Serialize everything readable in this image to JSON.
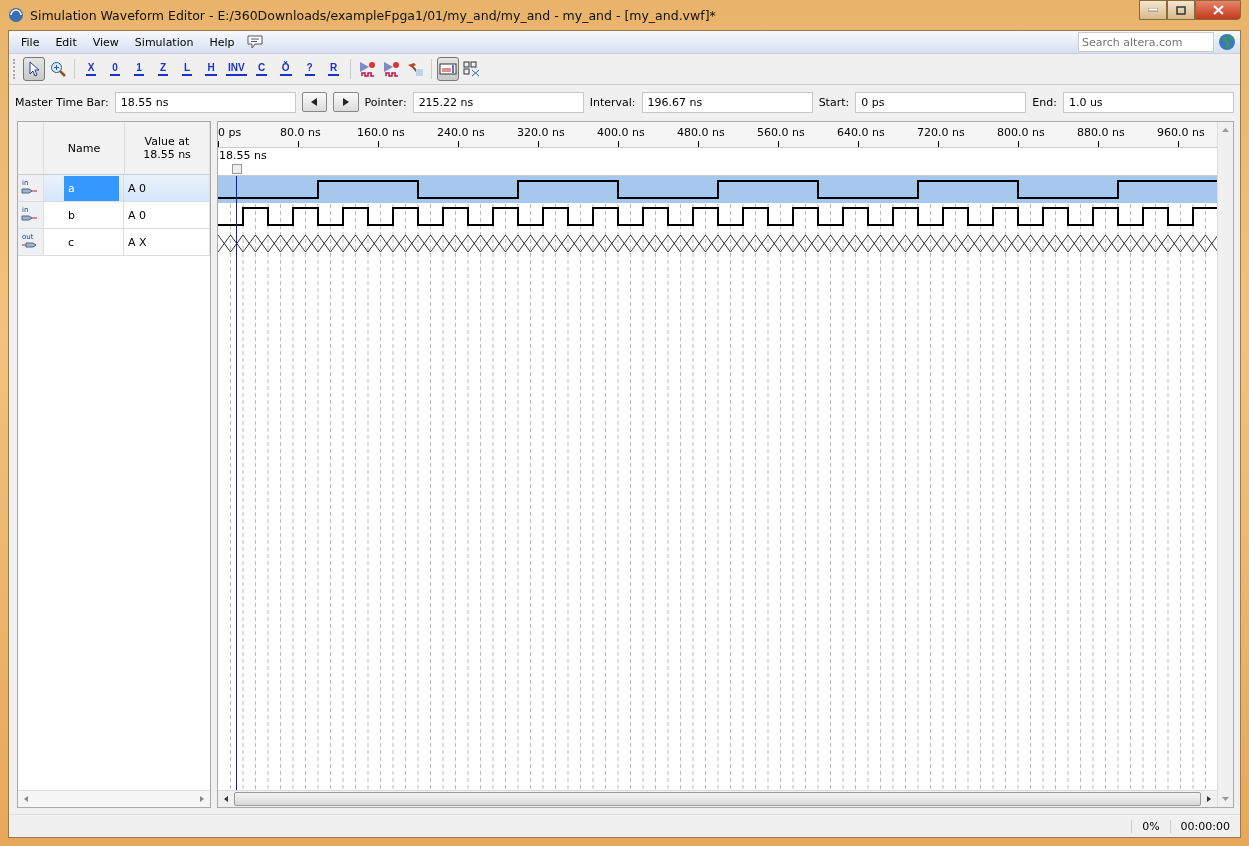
{
  "window": {
    "title": "Simulation Waveform Editor - E:/360Downloads/exampleFpga1/01/my_and/my_and - my_and - [my_and.vwf]*"
  },
  "menu": [
    "File",
    "Edit",
    "View",
    "Simulation",
    "Help"
  ],
  "search": {
    "placeholder": "Search altera.com"
  },
  "toolbar": [
    {
      "kind": "select",
      "selected": true
    },
    {
      "kind": "zoom",
      "selected": false
    },
    {
      "kind": "glyph",
      "glyph": "X",
      "selected": false
    },
    {
      "kind": "glyph",
      "glyph": "0",
      "selected": false
    },
    {
      "kind": "glyph",
      "glyph": "1",
      "selected": false
    },
    {
      "kind": "glyph",
      "glyph": "Z",
      "selected": false
    },
    {
      "kind": "glyph",
      "glyph": "L",
      "selected": false
    },
    {
      "kind": "glyph",
      "glyph": "H",
      "selected": false
    },
    {
      "kind": "glyph",
      "glyph": "INV",
      "selected": false
    },
    {
      "kind": "glyph",
      "glyph": "C",
      "selected": false
    },
    {
      "kind": "glyph",
      "glyph": "Ŏ",
      "selected": false
    },
    {
      "kind": "glyph",
      "glyph": "?",
      "selected": false
    },
    {
      "kind": "glyph",
      "glyph": "R",
      "selected": false
    },
    {
      "kind": "sim",
      "selected": false
    },
    {
      "kind": "sim",
      "selected": false
    },
    {
      "kind": "hammer",
      "selected": false
    },
    {
      "kind": "layout",
      "selected": true
    },
    {
      "kind": "grid",
      "selected": false
    }
  ],
  "timebar": {
    "master_label": "Master Time Bar:",
    "master": "18.55 ns",
    "pointer_label": "Pointer:",
    "pointer": "215.22 ns",
    "interval_label": "Interval:",
    "interval": "196.67 ns",
    "start_label": "Start:",
    "start": "0 ps",
    "end_label": "End:",
    "end": "1.0 us"
  },
  "table": {
    "columns": [
      "Name",
      "Value at 18.55 ns"
    ]
  },
  "ruler": {
    "ticks": [
      "0 ps",
      "80.0 ns",
      "160.0 ns",
      "240.0 ns",
      "320.0 ns",
      "400.0 ns",
      "480.0 ns",
      "560.0 ns",
      "640.0 ns",
      "720.0 ns",
      "800.0 ns",
      "880.0 ns",
      "960.0 ns"
    ],
    "master_marker": "18.55 ns"
  },
  "signals": [
    {
      "direction": "in",
      "name": "a",
      "value": "A 0",
      "selected": true,
      "kind": "binary",
      "high": [
        false,
        false,
        false,
        false,
        true,
        true,
        true,
        true,
        false,
        false,
        false,
        false,
        true,
        true,
        true,
        true,
        false,
        false,
        false,
        false,
        true,
        true,
        true,
        true,
        false,
        false,
        false,
        false,
        true,
        true,
        true,
        true,
        false,
        false,
        false,
        false,
        true,
        true,
        true,
        true
      ]
    },
    {
      "direction": "in",
      "name": "b",
      "value": "A 0",
      "selected": false,
      "kind": "binary",
      "high": [
        false,
        true,
        false,
        true,
        false,
        true,
        false,
        true,
        false,
        true,
        false,
        true,
        false,
        true,
        false,
        true,
        false,
        true,
        false,
        true,
        false,
        true,
        false,
        true,
        false,
        true,
        false,
        true,
        false,
        true,
        false,
        true,
        false,
        true,
        false,
        true,
        false,
        true,
        false,
        true
      ]
    },
    {
      "direction": "out",
      "name": "c",
      "value": "A X",
      "selected": false,
      "kind": "unknown"
    }
  ],
  "status_bar": {
    "progress": "0%",
    "elapsed": "00:00:00"
  }
}
